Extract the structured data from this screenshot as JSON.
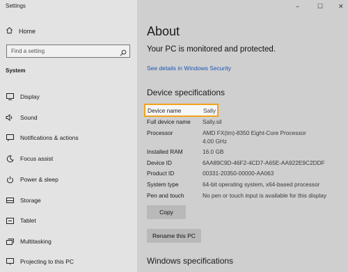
{
  "app": {
    "title": "Settings"
  },
  "sidebar": {
    "home_label": "Home",
    "search_placeholder": "Find a setting",
    "section_label": "System",
    "items": [
      {
        "label": "Display",
        "icon": "display-icon"
      },
      {
        "label": "Sound",
        "icon": "sound-icon"
      },
      {
        "label": "Notifications & actions",
        "icon": "notifications-icon"
      },
      {
        "label": "Focus assist",
        "icon": "focus-assist-icon"
      },
      {
        "label": "Power & sleep",
        "icon": "power-icon"
      },
      {
        "label": "Storage",
        "icon": "storage-icon"
      },
      {
        "label": "Tablet",
        "icon": "tablet-icon"
      },
      {
        "label": "Multitasking",
        "icon": "multitasking-icon"
      },
      {
        "label": "Projecting to this PC",
        "icon": "projecting-icon"
      }
    ]
  },
  "window_controls": {
    "minimize": "–",
    "maximize": "☐",
    "close": "✕"
  },
  "main": {
    "title": "About",
    "status": "Your PC is monitored and protected.",
    "security_link": "See details in Windows Security",
    "device_specs_title": "Device specifications",
    "specs": {
      "device_name": {
        "key": "Device name",
        "value": "Sally"
      },
      "full_device_name": {
        "key": "Full device name",
        "value": "Sally.sil"
      },
      "processor": {
        "key": "Processor",
        "value": "AMD FX(tm)-8350 Eight-Core Processor",
        "value2": "4.00 GHz"
      },
      "installed_ram": {
        "key": "Installed RAM",
        "value": "16.0 GB"
      },
      "device_id": {
        "key": "Device ID",
        "value": "6AA89C9D-46F2-4CD7-A65E-AA922E9C2DDF"
      },
      "product_id": {
        "key": "Product ID",
        "value": "00331-20350-00000-AA063"
      },
      "system_type": {
        "key": "System type",
        "value": "64-bit operating system, x64-based processor"
      },
      "pen_touch": {
        "key": "Pen and touch",
        "value": "No pen or touch input is available for this display"
      }
    },
    "copy_button": "Copy",
    "rename_button": "Rename this PC",
    "windows_specs_title": "Windows specifications"
  },
  "colors": {
    "sidebar_bg": "#e3e3e3",
    "main_bg": "#cfcfcf",
    "link": "#1c55b5",
    "highlight": "#f2a21b"
  }
}
